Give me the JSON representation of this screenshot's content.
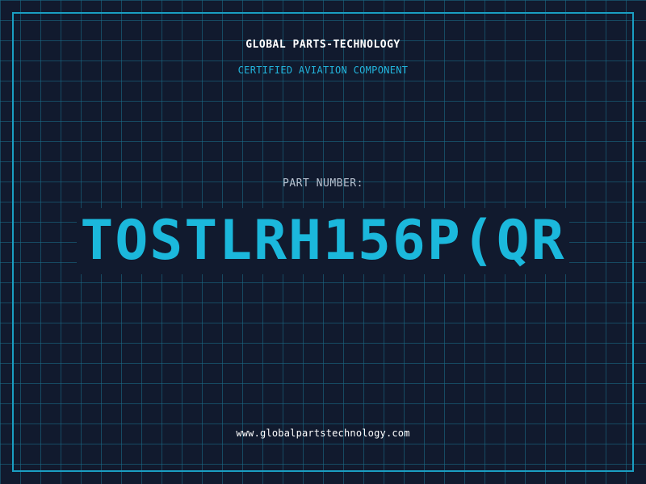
{
  "header": {
    "company": "GLOBAL PARTS-TECHNOLOGY",
    "subtitle": "CERTIFIED AVIATION COMPONENT"
  },
  "main": {
    "part_label": "PART NUMBER:",
    "part_number": "TOSTLRH156P(QR"
  },
  "footer": {
    "website": "www.globalpartstechnology.com"
  },
  "colors": {
    "background": "#111a2e",
    "grid": "#1a708c",
    "accent": "#1bb8dc",
    "frame": "#1a9ec2"
  }
}
